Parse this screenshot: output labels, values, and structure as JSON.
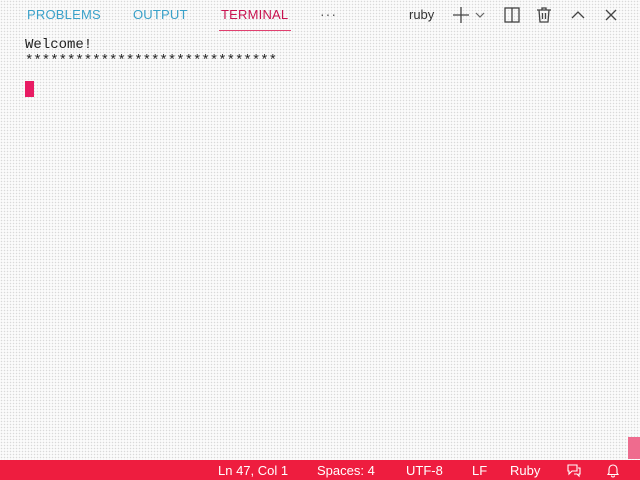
{
  "panel": {
    "tabs": [
      {
        "label": "PROBLEMS",
        "active": false
      },
      {
        "label": "OUTPUT",
        "active": false
      },
      {
        "label": "TERMINAL",
        "active": true
      }
    ],
    "more_label": "···",
    "shell_name": "ruby",
    "actions": [
      "plus-icon",
      "chevron-down-icon",
      "split-icon",
      "trash-icon",
      "chevron-up-icon",
      "close-icon"
    ]
  },
  "terminal": {
    "lines": [
      "Welcome!",
      "******************************"
    ]
  },
  "status_bar": {
    "position": "Ln 47, Col 1",
    "spaces": "Spaces: 4",
    "encoding": "UTF-8",
    "eol": "LF",
    "language": "Ruby",
    "icons": [
      "feedback-icon",
      "bell-icon"
    ]
  },
  "colors": {
    "accent": "#c8124f",
    "inactive_tab": "#3aa1c9",
    "status_bar": "#ee1d3f",
    "cursor": "#e81b63"
  }
}
